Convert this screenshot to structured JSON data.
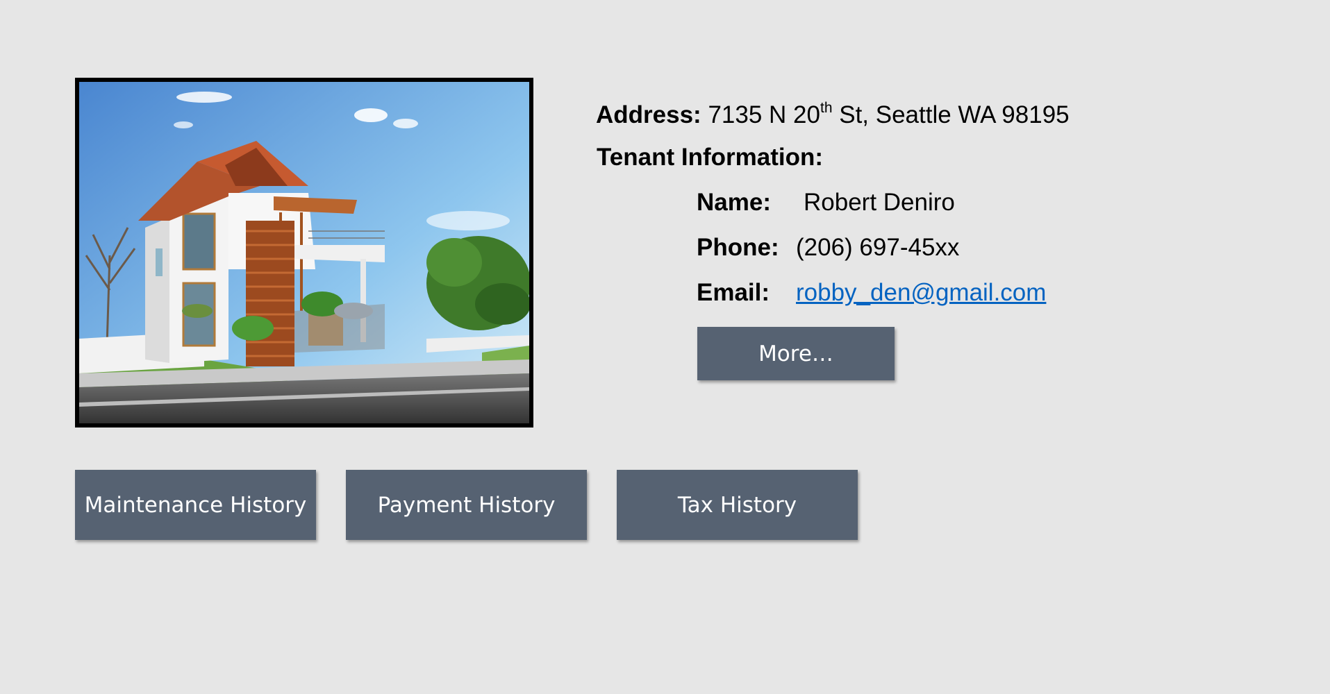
{
  "property": {
    "photo_icon": "house-photo",
    "address_label": "Address:",
    "address_prefix": "7135 N 20",
    "address_sup": "th",
    "address_suffix": " St, Seattle WA 98195"
  },
  "tenant": {
    "heading": "Tenant Information:",
    "name_label": "Name:",
    "name_value": "Robert Deniro",
    "phone_label": "Phone:",
    "phone_value": "(206) 697-45xx",
    "email_label": "Email:",
    "email_value": "robby_den@gmail.com",
    "more_label": "More…"
  },
  "actions": {
    "maintenance_label": "Maintenance History",
    "payment_label": "Payment History",
    "tax_label": "Tax History"
  },
  "colors": {
    "background": "#e6e6e6",
    "button": "#566272",
    "link": "#0563c1"
  }
}
